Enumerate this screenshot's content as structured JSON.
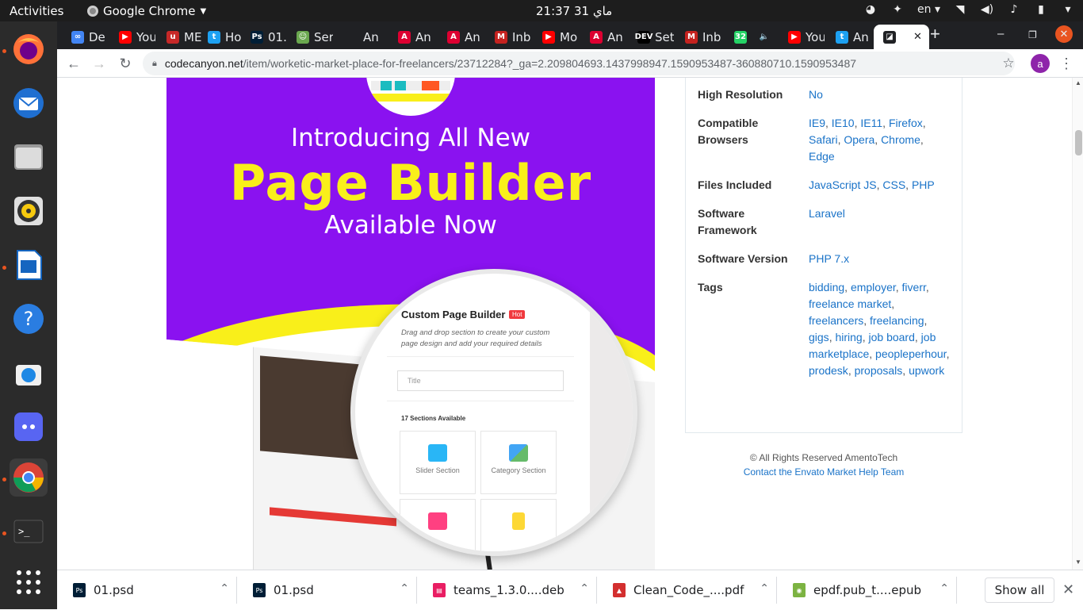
{
  "system": {
    "activities": "Activities",
    "app_name": "Google Chrome",
    "clock": "21:37  31 ماي",
    "language": "en"
  },
  "browser": {
    "tabs": [
      {
        "icon": "∞",
        "title": "De",
        "color": "#4285f4"
      },
      {
        "icon": "▶",
        "title": "You",
        "color": "#ff0000"
      },
      {
        "icon": "u",
        "title": "ME",
        "color": "#c62828"
      },
      {
        "icon": "t",
        "title": "Ho",
        "color": "#1da1f2"
      },
      {
        "icon": "Ps",
        "title": "01.",
        "color": "#001e36"
      },
      {
        "icon": "☺",
        "title": "Ser",
        "color": "#6aa84f"
      },
      {
        "icon": "",
        "title": "An",
        "color": "#202124"
      },
      {
        "icon": "A",
        "title": "An",
        "color": "#dd0031"
      },
      {
        "icon": "A",
        "title": "An",
        "color": "#dd0031"
      },
      {
        "icon": "M",
        "title": "Inb",
        "color": "#c5221f"
      },
      {
        "icon": "▶",
        "title": "Mo",
        "color": "#ff0000"
      },
      {
        "icon": "A",
        "title": "An",
        "color": "#dd0031"
      },
      {
        "icon": "DEV",
        "title": "Set",
        "color": "#000000"
      },
      {
        "icon": "M",
        "title": "Inb",
        "color": "#c5221f"
      },
      {
        "icon": "32",
        "title": "",
        "color": "#25d366"
      },
      {
        "icon": "🔈",
        "title": "",
        "color": "#202124"
      },
      {
        "icon": "▶",
        "title": "You",
        "color": "#ff0000"
      },
      {
        "icon": "t",
        "title": "An",
        "color": "#1da1f2"
      },
      {
        "icon": "◪",
        "title": "",
        "color": "#202124"
      }
    ],
    "url_host": "codecanyon.net",
    "url_path": "/item/worketic-market-place-for-freelancers/23712284?_ga=2.209804693.1437998947.1590953487-360880710.1590953487",
    "profile_initial": "a"
  },
  "promo": {
    "intro": "Introducing All New",
    "headline": "Page Builder",
    "available": "Available Now",
    "mag_title": "Custom Page Builder",
    "mag_hot": "Hot",
    "mag_desc": "Drag and drop section to create your custom page design and add your required details",
    "mag_input": "Title",
    "mag_sections": "17 Sections Available",
    "mag_card1": "Slider Section",
    "mag_card2": "Category Section"
  },
  "details": [
    {
      "label": "High Resolution",
      "values": [
        "No"
      ]
    },
    {
      "label": "Compatible Browsers",
      "values": [
        "IE9",
        "IE10",
        "IE11",
        "Firefox",
        "Safari",
        "Opera",
        "Chrome",
        "Edge"
      ]
    },
    {
      "label": "Files Included",
      "values": [
        "JavaScript JS",
        "CSS",
        "PHP"
      ]
    },
    {
      "label": "Software Framework",
      "values": [
        "Laravel"
      ]
    },
    {
      "label": "Software Version",
      "values": [
        "PHP 7.x"
      ]
    },
    {
      "label": "Tags",
      "values": [
        "bidding",
        "employer",
        "fiverr",
        "freelance market",
        "freelancers",
        "freelancing",
        "gigs",
        "hiring",
        "job board",
        "job marketplace",
        "peopleperhour",
        "prodesk",
        "proposals",
        "upwork"
      ]
    }
  ],
  "footer": {
    "copyright": "© All Rights Reserved AmentoTech",
    "help_link": "Contact the Envato Market Help Team"
  },
  "downloads": {
    "items": [
      {
        "name": "01.psd",
        "icon": "Ps",
        "color": "#001e36"
      },
      {
        "name": "01.psd",
        "icon": "Ps",
        "color": "#001e36"
      },
      {
        "name": "teams_1.3.0....deb",
        "icon": "▤",
        "color": "#e91e63"
      },
      {
        "name": "Clean_Code_....pdf",
        "icon": "▲",
        "color": "#d32f2f"
      },
      {
        "name": "epdf.pub_t....epub",
        "icon": "◉",
        "color": "#7cb342"
      }
    ],
    "show_all": "Show all"
  }
}
